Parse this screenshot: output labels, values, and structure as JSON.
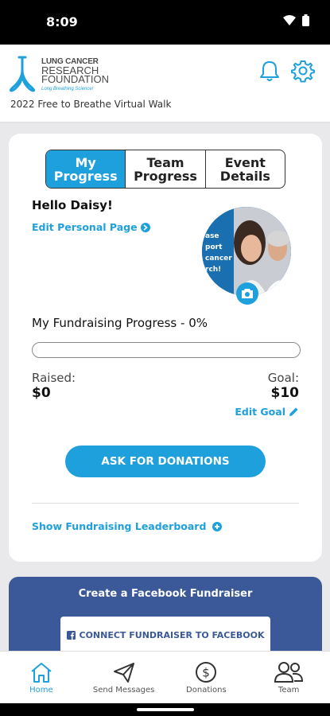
{
  "status_bar": {
    "time": "8:09"
  },
  "header": {
    "logo_line1": "LUNG CANCER",
    "logo_line2": "RESEARCH",
    "logo_line3": "FOUNDATION",
    "logo_tagline": "Long Breathing Science!",
    "event_title": "2022 Free to Breathe Virtual Walk",
    "bell_icon": "bell-icon",
    "settings_icon": "gear-icon"
  },
  "tabs": [
    {
      "label": "My\nProgress",
      "active": true
    },
    {
      "label": "Team\nProgress",
      "active": false
    },
    {
      "label": "Event\nDetails",
      "active": false
    }
  ],
  "greeting": "Hello Daisy!",
  "edit_personal_page": "Edit Personal Page",
  "avatar_text": "ase\nport\ncancer\nrch!",
  "progress": {
    "title": "My Fundraising Progress - 0%",
    "percent": 0,
    "raised_label": "Raised:",
    "raised_value": "$0",
    "goal_label": "Goal:",
    "goal_value": "$10",
    "edit_goal": "Edit Goal"
  },
  "ask_button": "ASK FOR DONATIONS",
  "leaderboard_link": "Show Fundraising Leaderboard",
  "facebook": {
    "title": "Create a Facebook Fundraiser",
    "button": "CONNECT FUNDRAISER TO FACEBOOK"
  },
  "bottom_nav": [
    {
      "label": "Home",
      "icon": "home-icon",
      "active": true
    },
    {
      "label": "Send Messages",
      "icon": "send-icon",
      "active": false
    },
    {
      "label": "Donations",
      "icon": "dollar-icon",
      "active": false
    },
    {
      "label": "Team",
      "icon": "team-icon",
      "active": false
    }
  ],
  "colors": {
    "accent": "#1ea0dc",
    "facebook": "#3b5998",
    "background": "#e9e9eb"
  }
}
